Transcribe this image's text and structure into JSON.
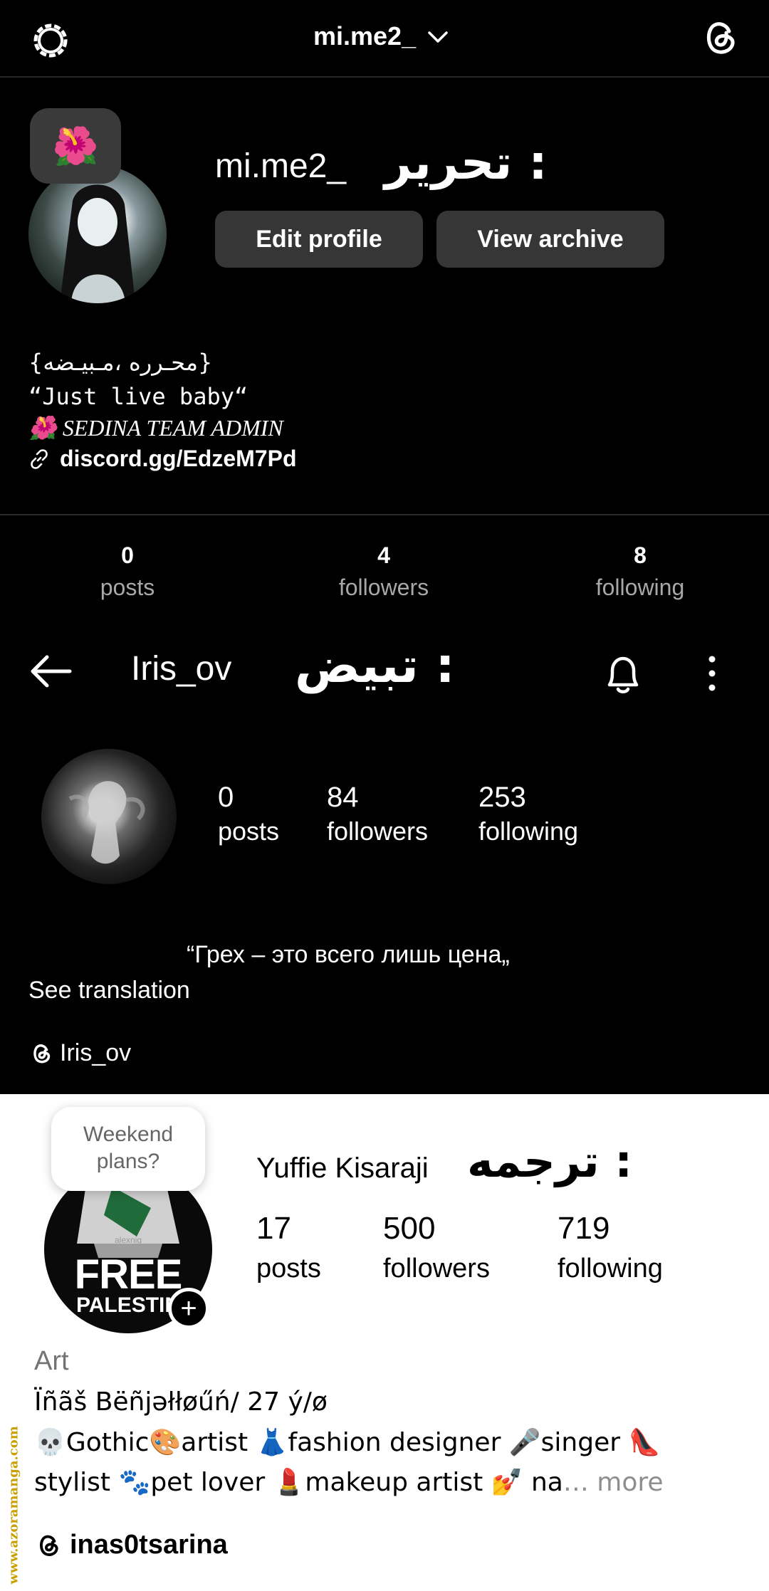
{
  "profile1": {
    "top_username": "mi.me2_",
    "note_emoji": "🌺",
    "name": "mi.me2_",
    "arabic_label": ": تحرير",
    "edit_button": "Edit profile",
    "archive_button": "View archive",
    "bio": {
      "line1": "{محـرره ،مـبيـضه}",
      "line2": "“Just live baby“",
      "line3": "🌺 SEDINA TEAM ADMIN",
      "link": "discord.gg/EdzeM7Pd"
    },
    "stats": [
      {
        "num": "0",
        "label": "posts"
      },
      {
        "num": "4",
        "label": "followers"
      },
      {
        "num": "8",
        "label": "following"
      }
    ]
  },
  "profile2": {
    "username": "Iris_ov",
    "arabic_label": ": تبيض",
    "stats": [
      {
        "num": "0",
        "label": "posts"
      },
      {
        "num": "84",
        "label": "followers"
      },
      {
        "num": "253",
        "label": "following"
      }
    ],
    "bio_quote": "“Грех – это всего лишь цена„",
    "see_translation": "See translation",
    "threads_link": "Iris_ov"
  },
  "profile3": {
    "note": "Weekend plans?",
    "avatar_text_top": "FREE",
    "avatar_text_bottom": "PALESTIN",
    "avatar_small_text": "alexnig",
    "name": "Yuffie Kisaraji",
    "arabic_label": ": ترجمه",
    "stats": [
      {
        "num": "17",
        "label": "posts"
      },
      {
        "num": "500",
        "label": "followers"
      },
      {
        "num": "719",
        "label": "following"
      }
    ],
    "category": "Art",
    "display_name": "Ïñãš Bëñjəłłøűń/ 27 ý/ø",
    "bio_line1": "💀Gothic🎨artist 👗fashion designer 🎤singer 👠",
    "bio_line2": "stylist 🐾pet lover 💄makeup artist 💅 na",
    "more": "… more",
    "threads_link": "inas0tsarina"
  },
  "watermark": "www.azoramanga.com",
  "colors": {
    "dark_bg": "#000000",
    "button_bg": "#363636",
    "muted_text": "#a8a8a8",
    "light_bg": "#ffffff"
  },
  "icons": [
    "gear-icon",
    "chevron-down-icon",
    "threads-icon",
    "link-icon",
    "back-arrow-icon",
    "bell-icon",
    "more-vertical-icon",
    "plus-icon"
  ]
}
